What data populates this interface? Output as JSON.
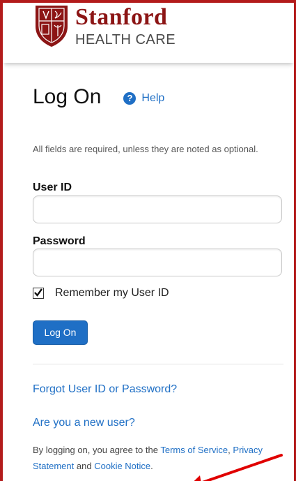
{
  "brand": {
    "name": "Stanford",
    "subtitle": "HEALTH CARE",
    "colors": {
      "cardinal": "#8c1515",
      "link_blue": "#1f6fc5",
      "frame_red": "#b31b1b",
      "annotation_red": "#e00000"
    }
  },
  "page": {
    "title": "Log On",
    "help_icon": "question-circle-icon",
    "help_label": "Help",
    "instructions": "All fields are required, unless they are noted as optional."
  },
  "form": {
    "user_id_label": "User ID",
    "user_id_value": "",
    "password_label": "Password",
    "password_value": "",
    "remember_label": "Remember my User ID",
    "remember_checked": true,
    "submit_label": "Log On"
  },
  "links": {
    "forgot": "Forgot User ID or Password?",
    "new_user": "Are you a new user?"
  },
  "legal": {
    "prefix": "By logging on, you agree to the",
    "terms": "Terms of Service",
    "comma": ",",
    "privacy": "Privacy Statement",
    "and": "and",
    "cookie": "Cookie Notice",
    "period": "."
  },
  "annotation": {
    "arrow_icon": "red-arrow-annotation"
  }
}
